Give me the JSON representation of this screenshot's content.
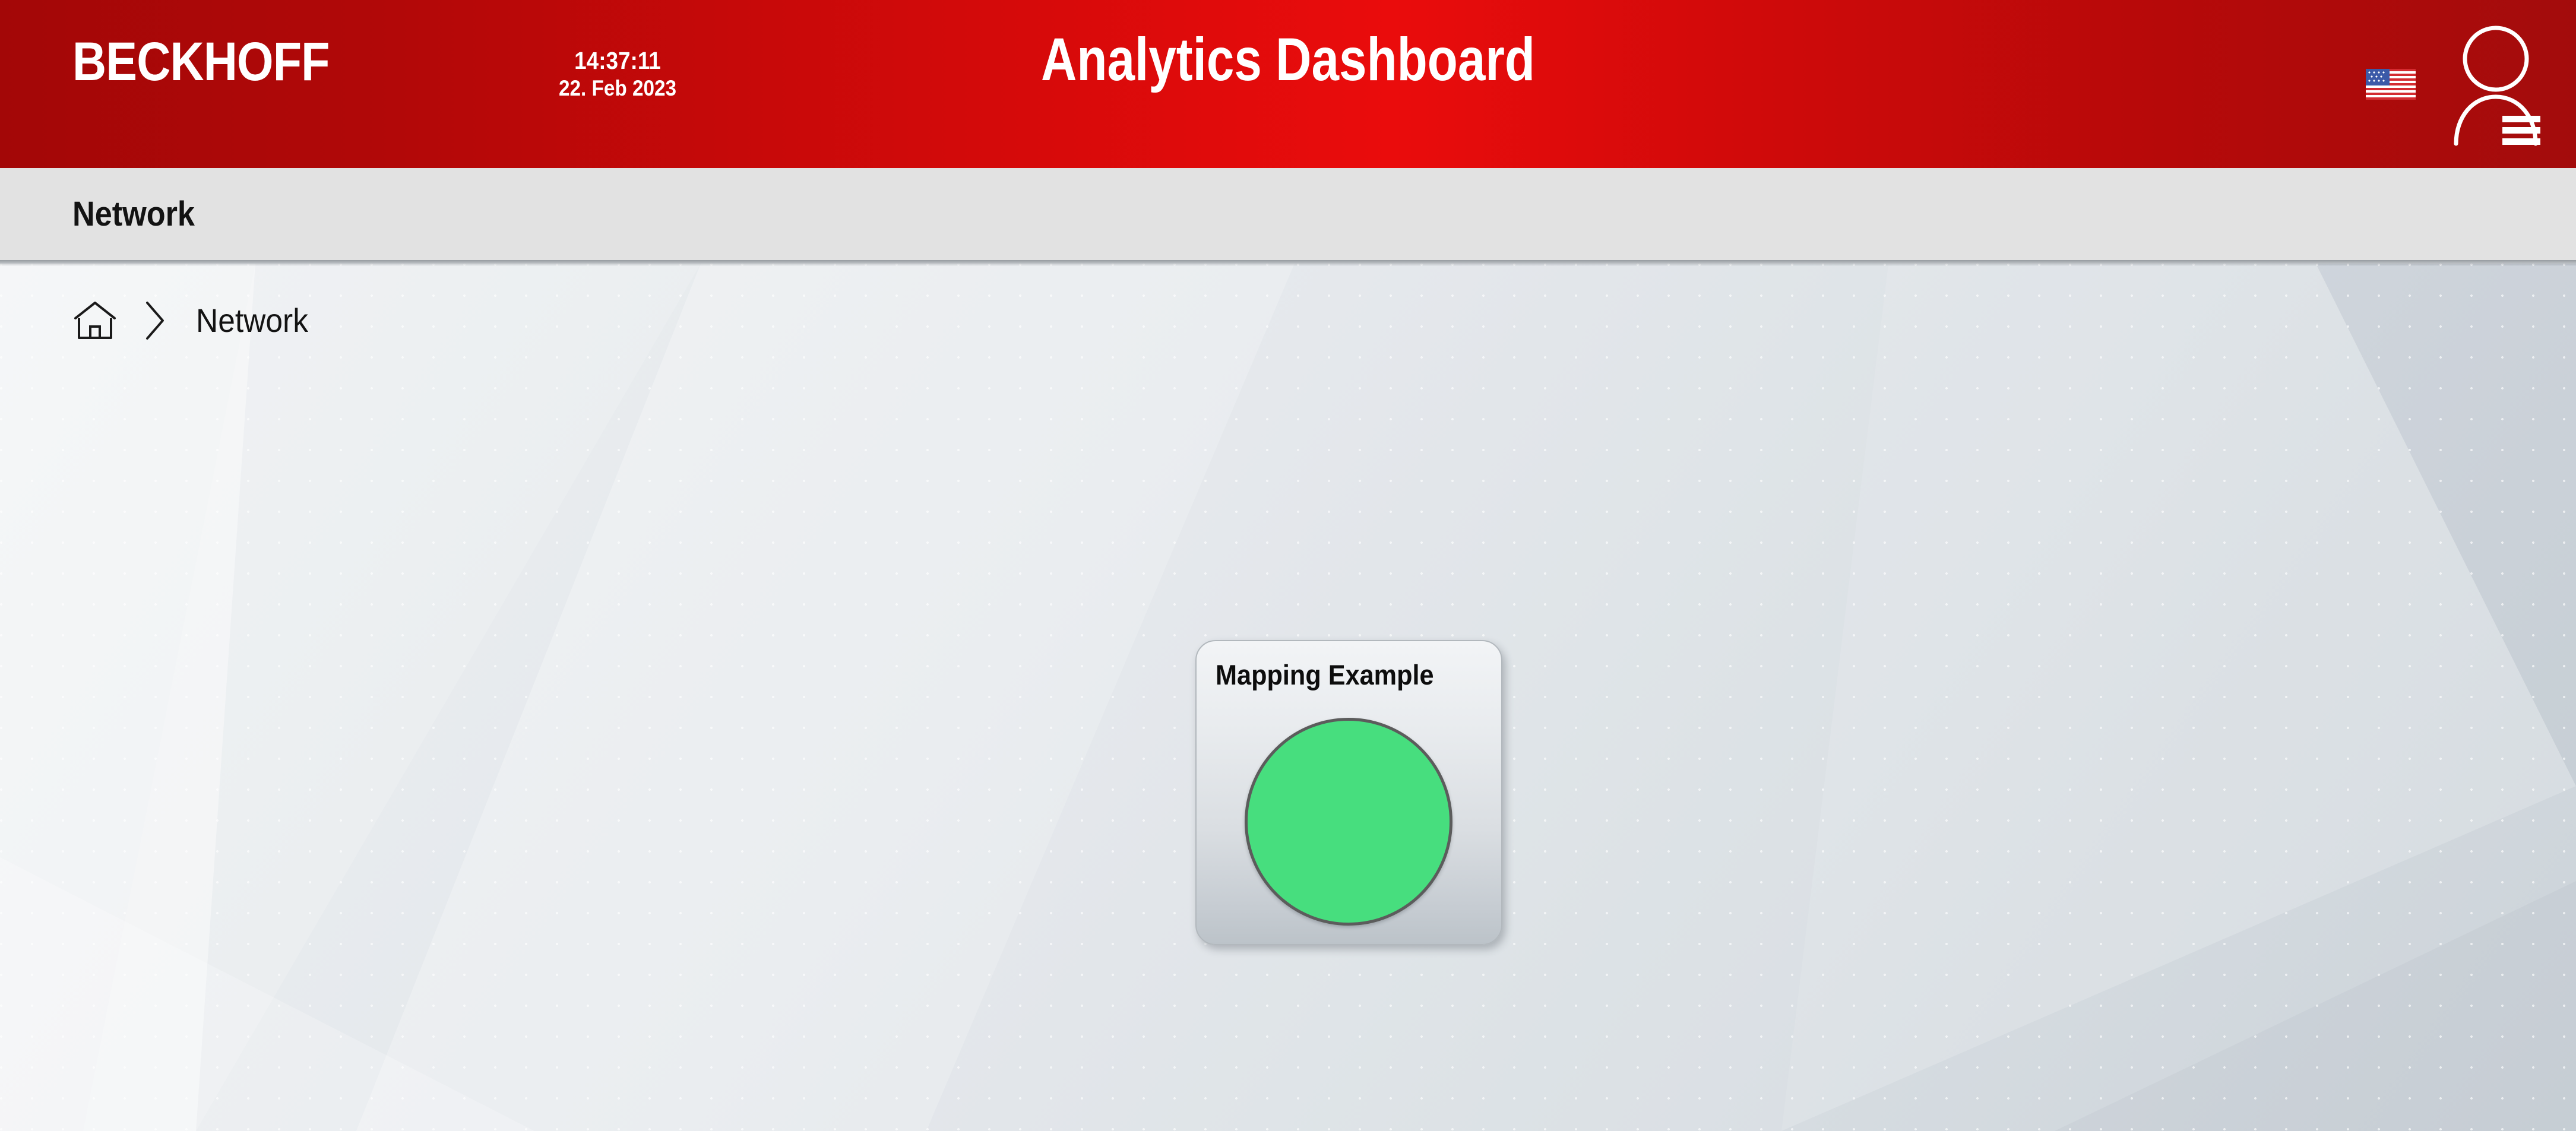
{
  "header": {
    "brand": "BECKHOFF",
    "clock": {
      "time": "14:37:11",
      "date": "22. Feb 2023"
    },
    "title": "Analytics Dashboard",
    "language_icon": "us-flag-icon",
    "user_icon": "user-account-menu-icon",
    "background_color_left": "#a30707",
    "background_color_mid": "#ea0c0c",
    "background_color_right": "#a30c0c"
  },
  "navbar": {
    "title": "Network",
    "background_color": "#e2e2e2"
  },
  "breadcrumb": {
    "home_icon": "home-icon",
    "separator_icon": "chevron-right-icon",
    "current": "Network"
  },
  "widget": {
    "title": "Mapping Example",
    "lamp": {
      "icon": "status-lamp-circle",
      "color": "#47de7e",
      "border_color": "#5c5c5c"
    }
  }
}
